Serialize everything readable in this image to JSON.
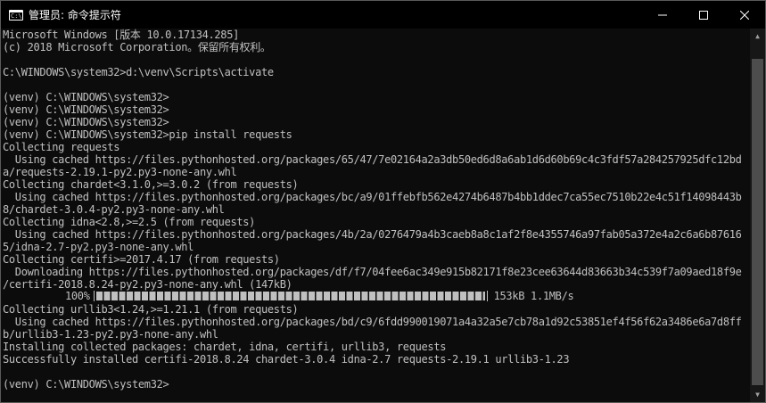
{
  "titlebar": {
    "title": "管理员: 命令提示符",
    "icon_label": "C:\\",
    "minimize_glyph": "—",
    "maximize_glyph": "☐",
    "close_glyph": "✕"
  },
  "console": {
    "lines": [
      "Microsoft Windows [版本 10.0.17134.285]",
      "(c) 2018 Microsoft Corporation。保留所有权利。",
      "",
      "C:\\WINDOWS\\system32>d:\\venv\\Scripts\\activate",
      "",
      "(venv) C:\\WINDOWS\\system32>",
      "(venv) C:\\WINDOWS\\system32>",
      "(venv) C:\\WINDOWS\\system32>",
      "(venv) C:\\WINDOWS\\system32>pip install requests",
      "Collecting requests",
      "  Using cached https://files.pythonhosted.org/packages/65/47/7e02164a2a3db50ed6d8a6ab1d6d60b69c4c3fdf57a284257925dfc12bd",
      "a/requests-2.19.1-py2.py3-none-any.whl",
      "Collecting chardet<3.1.0,>=3.0.2 (from requests)",
      "  Using cached https://files.pythonhosted.org/packages/bc/a9/01ffebfb562e4274b6487b4bb1ddec7ca55ec7510b22e4c51f14098443b",
      "8/chardet-3.0.4-py2.py3-none-any.whl",
      "Collecting idna<2.8,>=2.5 (from requests)",
      "  Using cached https://files.pythonhosted.org/packages/4b/2a/0276479a4b3caeb8a8c1af2f8e4355746a97fab05a372e4a2c6a6b87616",
      "5/idna-2.7-py2.py3-none-any.whl",
      "Collecting certifi>=2017.4.17 (from requests)",
      "  Downloading https://files.pythonhosted.org/packages/df/f7/04fee6ac349e915b82171f8e23cee63644d83663b34c539f7a09aed18f9e",
      "/certifi-2018.8.24-py2.py3-none-any.whl (147kB)",
      "",
      "Collecting urllib3<1.24,>=1.21.1 (from requests)",
      "  Using cached https://files.pythonhosted.org/packages/bd/c9/6fdd990019071a4a32a5e7cb78a1d92c53851ef4f56f62a3486e6a7d8ff",
      "b/urllib3-1.23-py2.py3-none-any.whl",
      "Installing collected packages: chardet, idna, certifi, urllib3, requests",
      "Successfully installed certifi-2018.8.24 chardet-3.0.4 idna-2.7 requests-2.19.1 urllib3-1.23",
      "",
      "(venv) C:\\WINDOWS\\system32>"
    ],
    "progress": {
      "percent_label": "100%",
      "fill_fraction": 1.0,
      "stats": "153kB 1.1MB/s"
    }
  },
  "scrollbar": {
    "up_glyph": "▲",
    "down_glyph": "▼"
  },
  "colors": {
    "background": "#0c0c0c",
    "text": "#c0c0c0",
    "titlebar": "#000000"
  }
}
